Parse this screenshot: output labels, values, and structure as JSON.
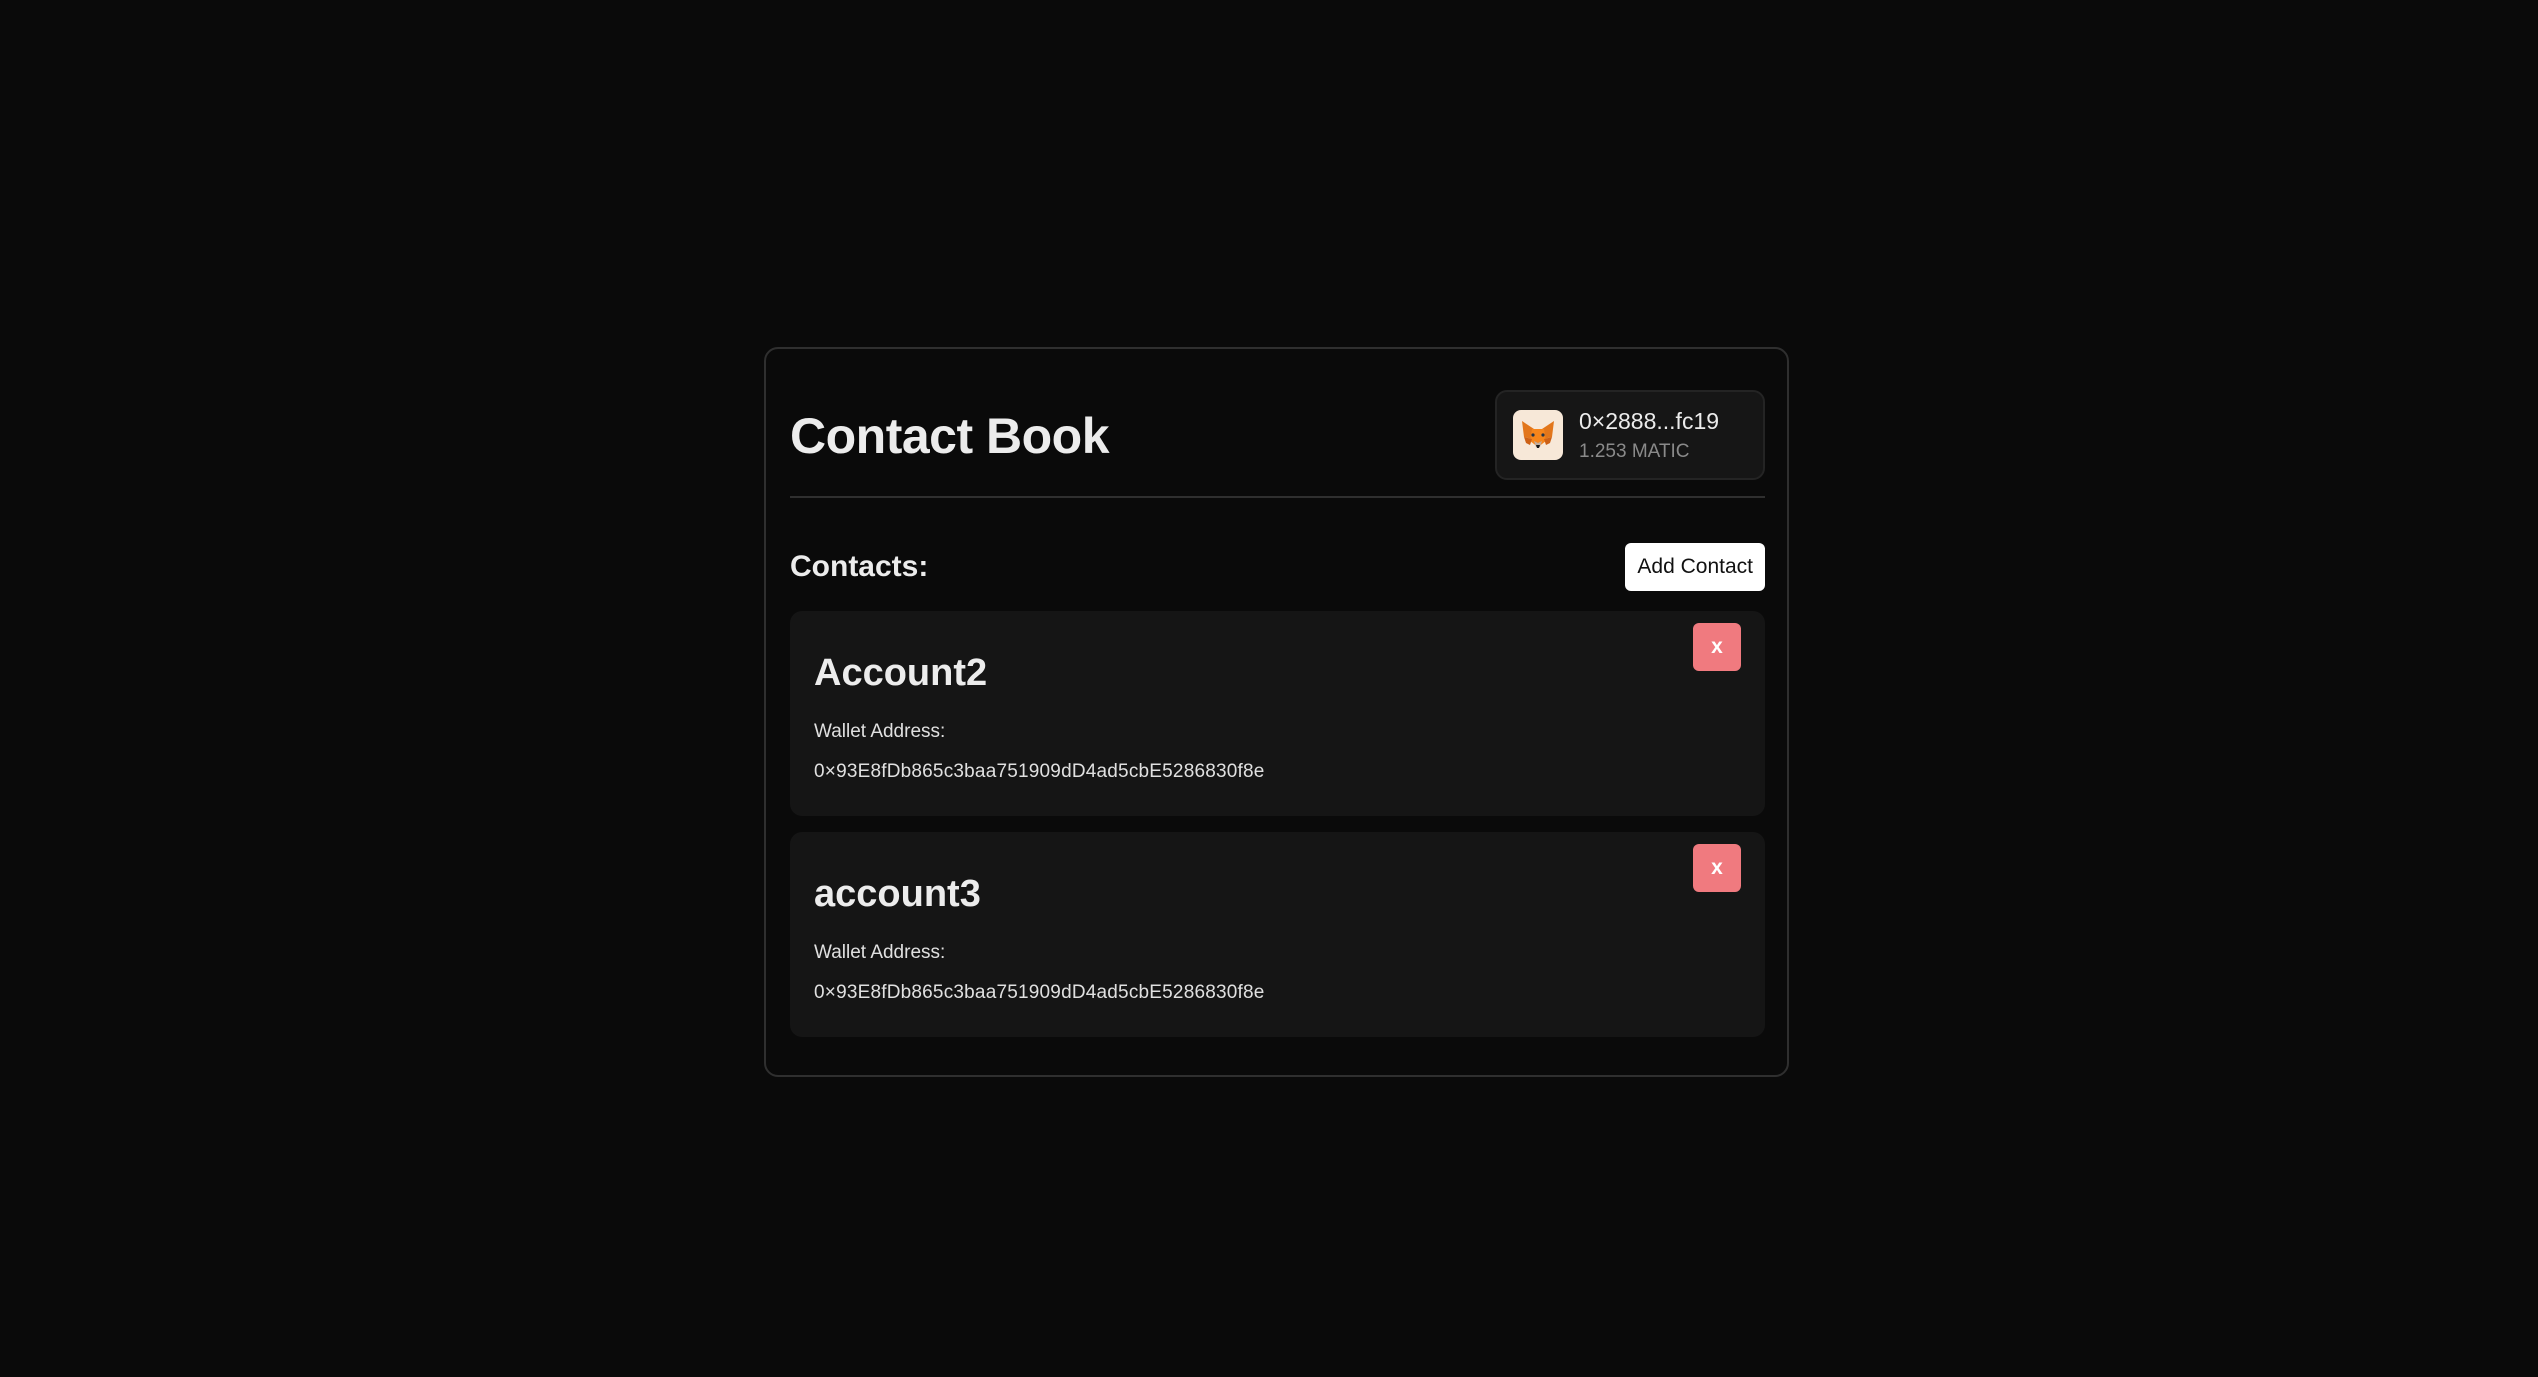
{
  "app": {
    "title": "Contact Book"
  },
  "wallet": {
    "address": "0×2888...fc19",
    "balance": "1.253 MATIC",
    "avatar_icon": "metamask-fox-icon"
  },
  "contacts_section": {
    "heading": "Contacts:",
    "add_button_label": "Add Contact"
  },
  "contacts": [
    {
      "name": "Account2",
      "address_label": "Wallet Address:",
      "address": "0×93E8fDb865c3baa751909dD4ad5cbE5286830f8e",
      "delete_label": "x"
    },
    {
      "name": "account3",
      "address_label": "Wallet Address:",
      "address": "0×93E8fDb865c3baa751909dD4ad5cbE5286830f8e",
      "delete_label": "x"
    }
  ],
  "colors": {
    "background": "#0a0a0a",
    "card_surface": "#151515",
    "delete_accent": "#f07a7f"
  }
}
